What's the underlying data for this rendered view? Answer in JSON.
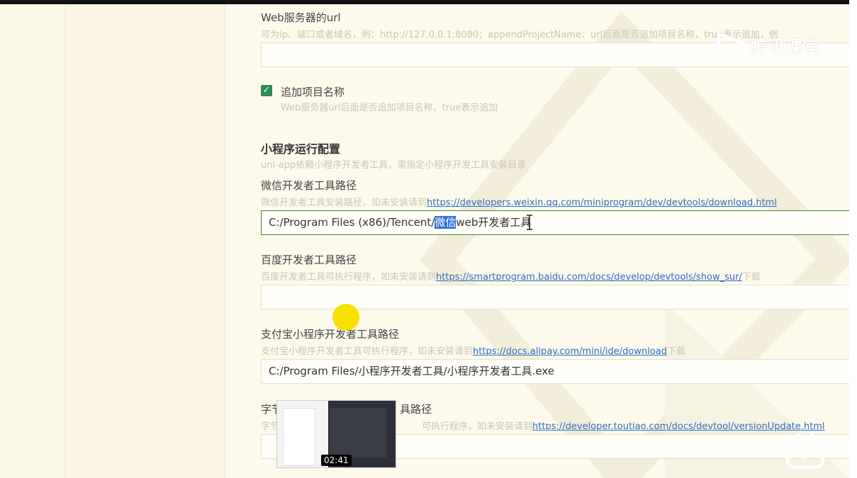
{
  "web_server": {
    "label": "Web服务器的url",
    "description": "可为ip、端口或者域名，例：http://127.0.0.1:8080；appendProjectName：url后面是否追加项目名称，true表示追加，例",
    "value": ""
  },
  "append_project": {
    "label": "追加项目名称",
    "description": "Web服务器url后面是否追加项目名称，true表示追加",
    "checked": true
  },
  "miniprogram": {
    "heading": "小程序运行配置",
    "description": "uni-app依赖小程序开发者工具，需指定小程序开发工具安装目录"
  },
  "wechat": {
    "label": "微信开发者工具路径",
    "description_prefix": "微信开发者工具安装路径，如未安装请到",
    "link": "https://developers.weixin.qq.com/miniprogram/dev/devtools/download.html",
    "value_before": "C:/Program Files (x86)/Tencent/",
    "value_selected": "微信",
    "value_after": "web开发者工具"
  },
  "baidu": {
    "label": "百度开发者工具路径",
    "description_prefix": "百度开发者工具可执行程序，如未安装请到",
    "link": "https://smartprogram.baidu.com/docs/develop/devtools/show_sur/",
    "description_suffix": "下载",
    "value": ""
  },
  "alipay": {
    "label": "支付宝小程序开发者工具路径",
    "description_prefix": "支付宝小程序开发者工具可执行程序，如未安装请到",
    "link": "https://docs.alipay.com/mini/ide/download",
    "description_suffix": "下载",
    "value": "C:/Program Files/小程序开发者工具/小程序开发者工具.exe"
  },
  "toutiao": {
    "label_start": "字节",
    "label_end": "具路径",
    "desc_start": "字节",
    "desc_end": "可执行程序，如未安装请到",
    "link": "https://developer.toutiao.com/docs/devtool/versionUpdate.html",
    "value": ""
  },
  "video": {
    "timestamp": "02:41",
    "watermark": "腾讯课堂"
  },
  "colors": {
    "background": "#fdfaec",
    "link": "#2b6cc4",
    "checkbox": "#2c8d55",
    "selection": "#2f72d6",
    "focus_border": "#3a8a3a"
  }
}
